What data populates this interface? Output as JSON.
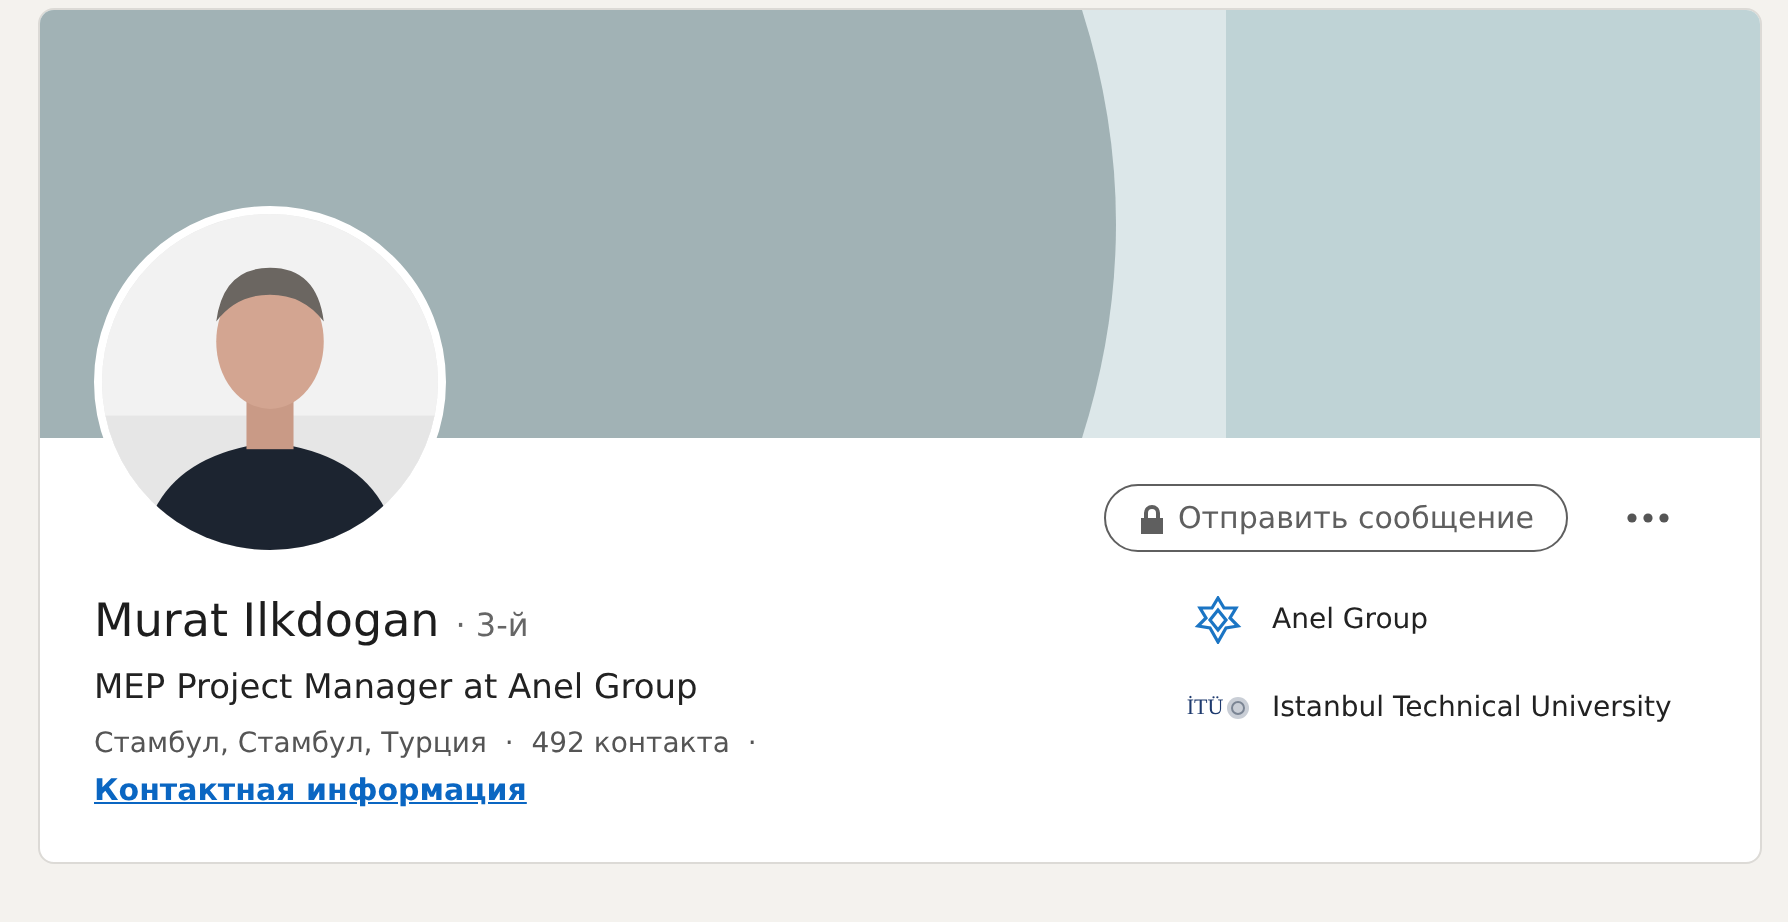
{
  "profile": {
    "name": "Murat Ilkdogan",
    "degree": "· 3-й",
    "headline": "MEP Project Manager at Anel Group",
    "location_line": "Стамбул, Стамбул, Турция  ·  492 контакта  ·",
    "contact_link": "Контактная информация"
  },
  "message_button": {
    "label": "Отправить сообщение"
  },
  "affiliations": [
    {
      "kind": "company",
      "name": "Anel Group"
    },
    {
      "kind": "school",
      "logo_text": "İTÜ",
      "name": "Istanbul Technical University"
    }
  ]
}
